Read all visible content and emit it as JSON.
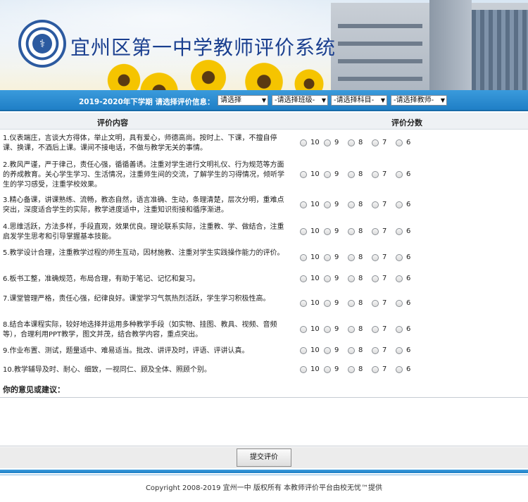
{
  "header": {
    "title": "宜州区第一中学教师评价系统",
    "logo_glyph": "⚕"
  },
  "filter": {
    "label": "2019-2020年下学期 请选择评价信息：",
    "selects": [
      "请选择",
      "-请选择班级-",
      "-请选择科目-",
      "-请选择教师-"
    ]
  },
  "table": {
    "col_content": "评价内容",
    "col_score": "评价分数",
    "score_options": [
      "10",
      "9",
      "8",
      "7",
      "6"
    ],
    "rows": [
      "1.仪表端庄，言谈大方得体，举止文明，具有爱心，师德高尚。按时上、下课，不擅自停课、换课，不酒后上课。课间不接电话，不做与教学无关的事情。",
      "2.教风严谨，严于律己，责任心强，循循善诱。注重对学生进行文明礼仪、行为规范等方面的养成教育。关心学生学习、生活情况，注重师生间的交流，了解学生的习得情况，倾听学生的学习感受，注重学校效果。",
      "3.精心备课，讲课熟练、流畅，教态自然，语言准确、生动，条理清楚，层次分明，重难点突出，深度适合学生的实际，教学进度适中，注重知识衔接和循序渐进。",
      "4.思维活跃，方法多样，手段直观，效果优良。理论联系实际，注重教、学、做结合，注重启发学生思考和引导掌握基本技能。",
      "5.教学设计合理，注重教学过程的师生互动，因材施教、注重对学生实践操作能力的评价。",
      "6.板书工整，准确规范，布局合理，有助于笔记、记忆和复习。",
      "7.课堂管理严格，责任心强，纪律良好。课堂学习气氛热烈活跃，学生学习积极性高。",
      "8.结合本课程实际，较好地选择并运用多种教学手段（如实物、挂图、教具、视频、音频等），合理利用PPT教学，图文并茂，结合教学内容，重点突出。",
      "9.作业布置、测试，题量适中、难易适当。批改、讲评及时，评语、评讲认真。",
      "10.教学辅导及时、耐心、细致，一视同仁、顾及全体、照顾个别。"
    ]
  },
  "opinion": {
    "label": "你的意见或建议："
  },
  "submit": {
    "label": "提交评价"
  },
  "footer": {
    "copyright": "Copyright 2008-2019 宜州一中 版权所有 本教师评价平台由校无忧™提供"
  }
}
